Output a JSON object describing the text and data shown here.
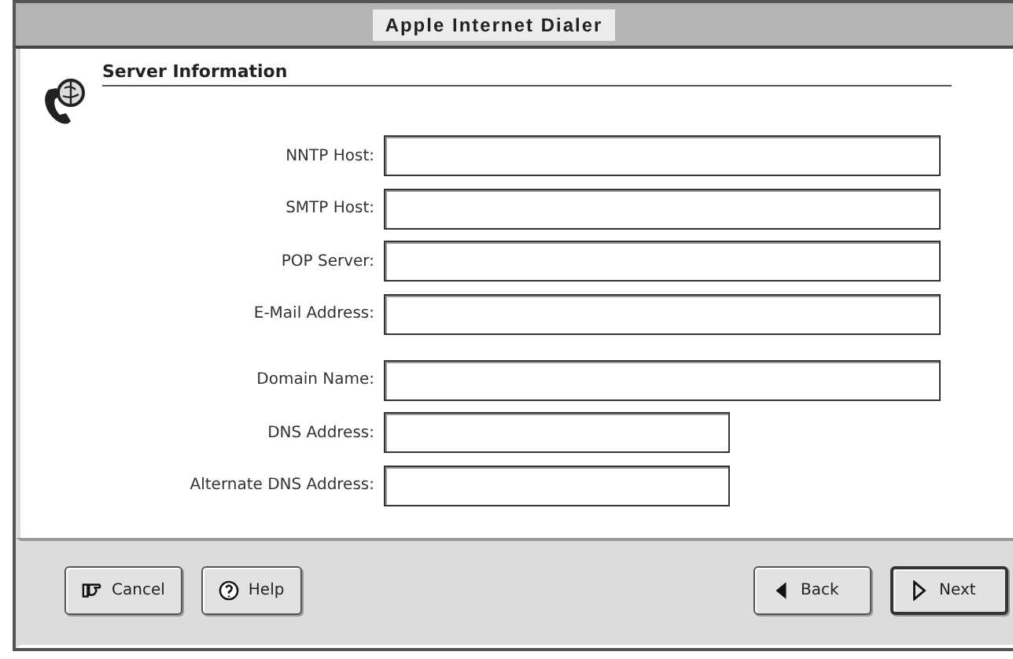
{
  "window": {
    "title": "Apple Internet Dialer"
  },
  "section": {
    "title": "Server Information"
  },
  "groups": [
    {
      "fields": [
        {
          "label": "NNTP Host:",
          "kind": "long"
        },
        {
          "label": "SMTP Host:",
          "kind": "long"
        },
        {
          "label": "POP Server:",
          "kind": "long"
        },
        {
          "label": "E-Mail Address:",
          "kind": "long"
        }
      ]
    },
    {
      "fields": [
        {
          "label": "Domain Name:",
          "kind": "long"
        },
        {
          "label": "DNS Address:",
          "kind": "short"
        },
        {
          "label": "Alternate DNS Address:",
          "kind": "short"
        }
      ]
    }
  ],
  "buttons_left": [
    {
      "label": "Cancel",
      "kind": "cancel",
      "default": false
    },
    {
      "label": "Help",
      "kind": "help",
      "default": false
    }
  ],
  "buttons_right": [
    {
      "label": "Back",
      "kind": "back",
      "default": false
    },
    {
      "label": "Next",
      "kind": "next",
      "default": true
    }
  ]
}
